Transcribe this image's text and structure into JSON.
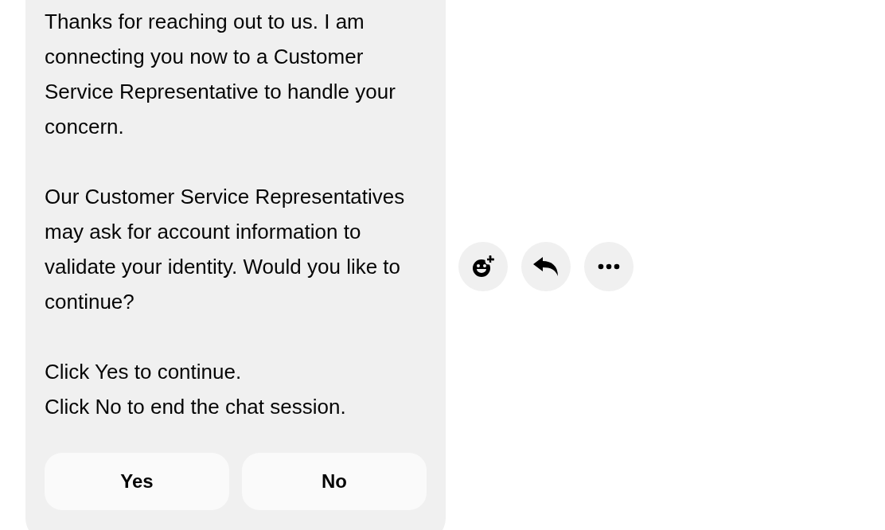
{
  "message": {
    "paragraphs": [
      [
        "Thanks for reaching out to us. I am connecting you now to a Customer Service Representative to handle your concern."
      ],
      [
        "Our Customer Service Representatives may ask for account information to validate your identity. Would you like to continue?"
      ],
      [
        "Click Yes to continue.",
        "Click No to end the chat session."
      ]
    ],
    "buttons": [
      "Yes",
      "No"
    ]
  },
  "actions": [
    {
      "kind": "react"
    },
    {
      "kind": "reply"
    },
    {
      "kind": "more"
    }
  ]
}
